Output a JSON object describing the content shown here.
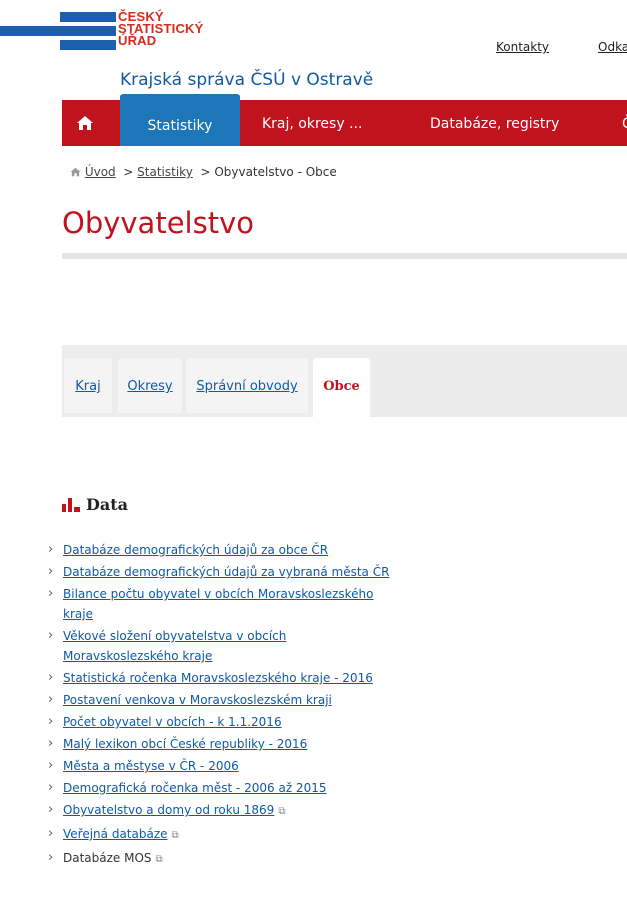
{
  "header": {
    "logo_lines": [
      "ČESKÝ",
      "STATISTICKÝ",
      "ÚŘAD"
    ],
    "top_links": [
      "Kontakty",
      "Odka"
    ],
    "region_title": "Krajská správa ČSÚ v Ostravě"
  },
  "nav": {
    "home_icon": "home-icon",
    "items": [
      "Statistiky",
      "Kraj, okresy ...",
      "Databáze, registry",
      "Č"
    ],
    "active": "Statistiky"
  },
  "breadcrumb": {
    "home_icon": "home-icon",
    "items": [
      "Úvod",
      "Statistiky",
      "Obyvatelstvo - Obce"
    ]
  },
  "page_title": "Obyvatelstvo",
  "tabs": [
    "Kraj",
    "Okresy",
    "Správní obvody",
    "Obce"
  ],
  "data_section": {
    "icon": "bar-chart-icon",
    "heading": "Data",
    "links": [
      "Databáze demografických údajů za obce ČR",
      "Databáze demografických údajů za vybraná města ČR",
      "Bilance počtu obyvatel v obcích Moravskoslezského kraje",
      "Věkové složení obyvatelstva v obcích Moravskoslezského kraje",
      "Statistická ročenka Moravskoslezského kraje - 2016",
      "Postavení venkova v Moravskoslezském kraji",
      "Počet obyvatel v obcích - k 1.1.2016",
      "Malý lexikon obcí České republiky - 2016",
      "Města a městyse v ČR - 2006",
      "Demografická ročenka měst - 2006 až 2015",
      "Obyvatelstvo a domy od roku 1869",
      "Veřejná databáze",
      "Databáze MOS"
    ]
  },
  "colors": {
    "brand_red": "#c1131e",
    "brand_blue": "#1c76b8",
    "link_blue": "#0f5aa3"
  }
}
